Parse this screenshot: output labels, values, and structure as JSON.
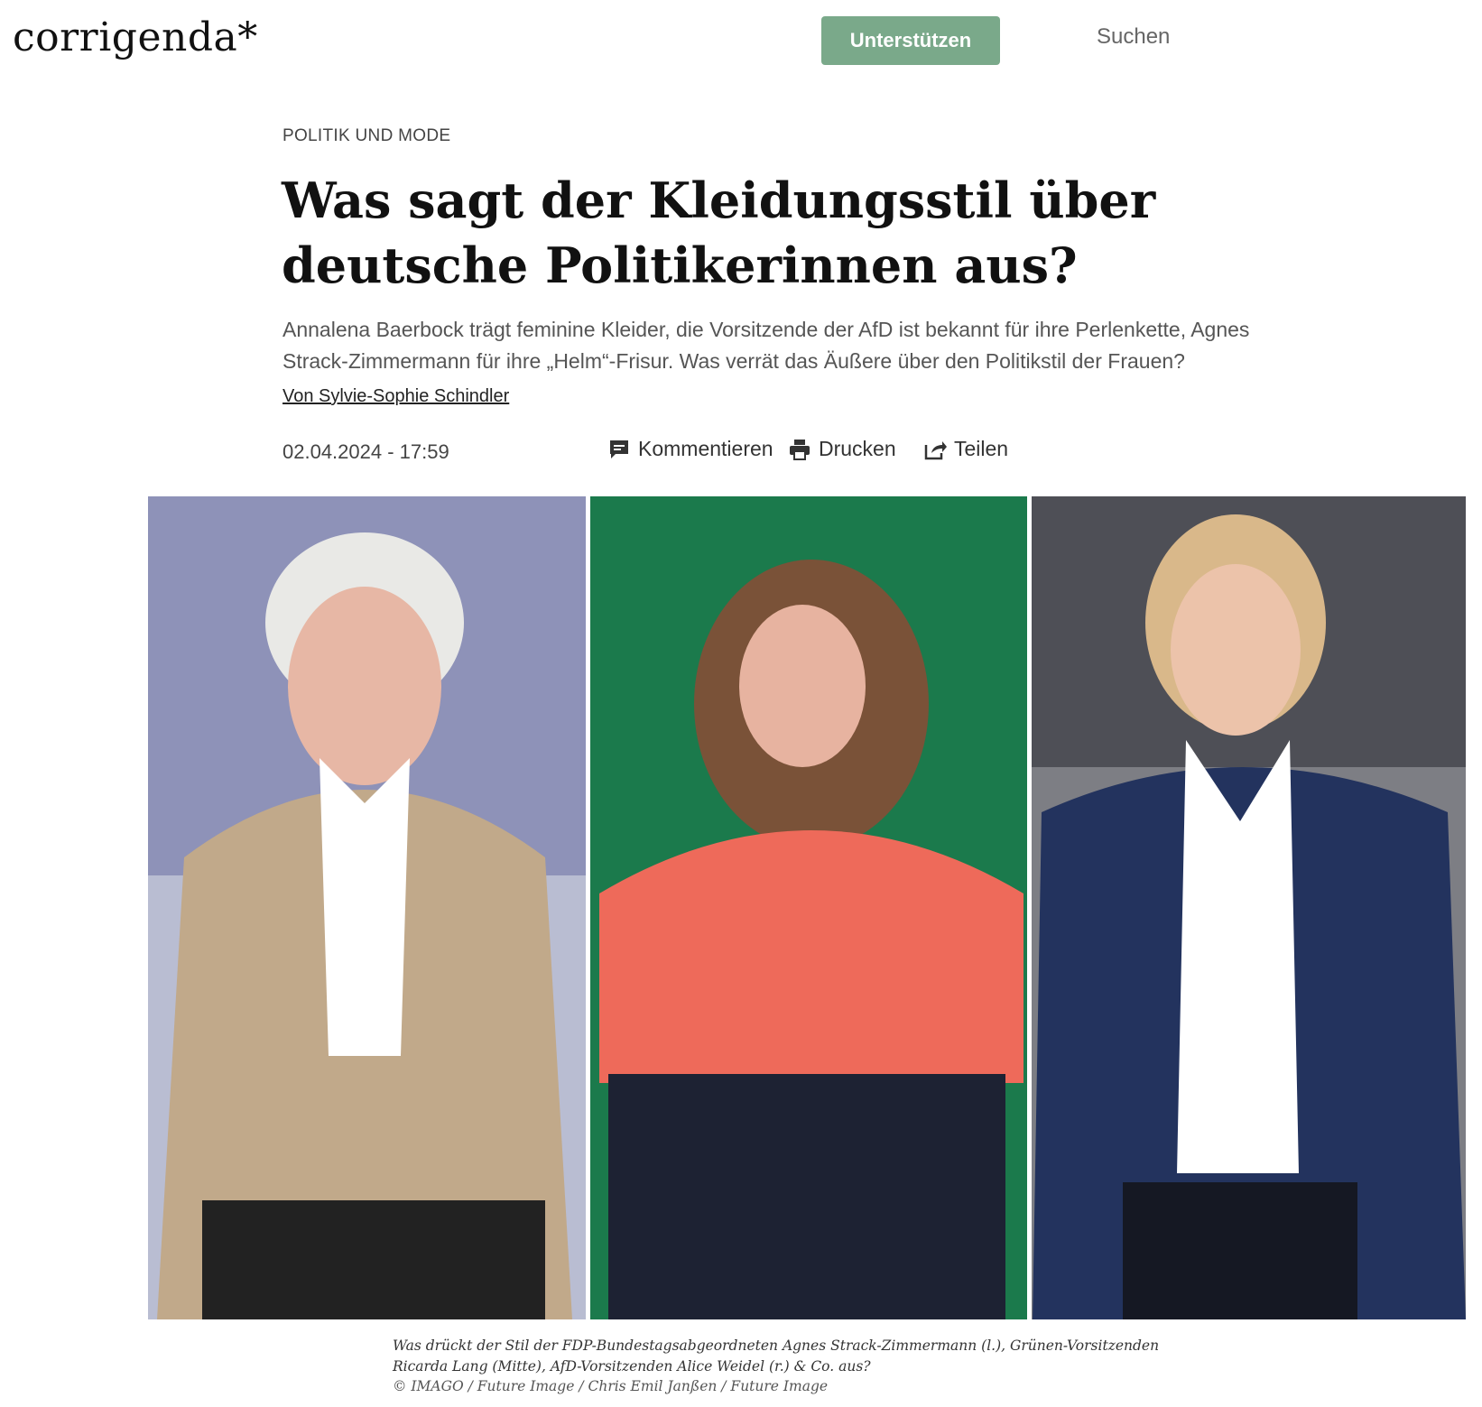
{
  "header": {
    "logo": "corrigenda*",
    "support_label": "Unterstützen",
    "search_label": "Suchen"
  },
  "article": {
    "kicker": "POLITIK UND MODE",
    "headline": "Was sagt der Kleidungsstil über deutsche Politikerinnen aus?",
    "lead": "Annalena Baerbock trägt feminine Kleider, die Vorsitzende der AfD ist bekannt für ihre Perlenkette, Agnes Strack-Zimmermann für ihre „Helm“-Frisur. Was verrät das Äußere über den Politikstil der Frauen?",
    "byline": "Von Sylvie-Sophie Schindler",
    "date": "02.04.2024 - 17:59",
    "actions": {
      "comment": "Kommentieren",
      "print": "Drucken",
      "share": "Teilen"
    }
  },
  "figure": {
    "caption": "Was drückt der Stil der FDP-Bundestagsabgeordneten Agnes Strack-Zimmermann (l.), Grünen-Vorsitzenden Ricarda Lang (Mitte), AfD-Vorsitzenden Alice Weidel (r.) & Co. aus?",
    "credit": "© IMAGO / Future Image / Chris Emil Janßen / Future Image"
  },
  "colors": {
    "accent": "#7aa98a"
  }
}
